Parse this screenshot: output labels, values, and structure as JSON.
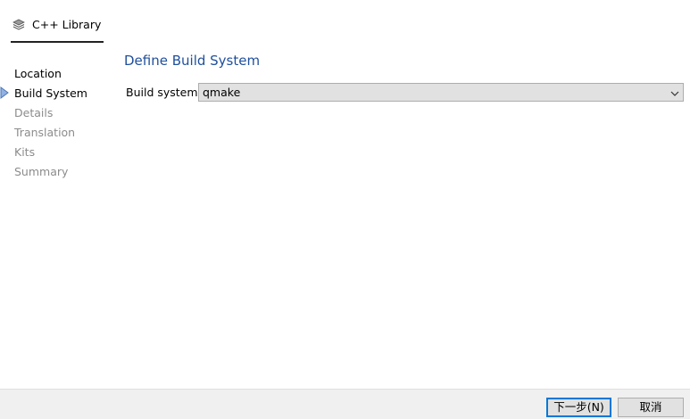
{
  "header": {
    "tab_label": "C++ Library",
    "tab_icon": "stack-icon"
  },
  "steps": [
    {
      "label": "Location",
      "state": "done"
    },
    {
      "label": "Build System",
      "state": "current"
    },
    {
      "label": "Details",
      "state": "pending"
    },
    {
      "label": "Translation",
      "state": "pending"
    },
    {
      "label": "Kits",
      "state": "pending"
    },
    {
      "label": "Summary",
      "state": "pending"
    }
  ],
  "main": {
    "title": "Define Build System",
    "build_system_label": "Build system:",
    "build_system_value": "qmake"
  },
  "footer": {
    "next_label": "下一步(N)",
    "cancel_label": "取消"
  },
  "colors": {
    "title": "#1f4f9c",
    "pending": "#8c8c8c",
    "accent": "#0078d7"
  }
}
